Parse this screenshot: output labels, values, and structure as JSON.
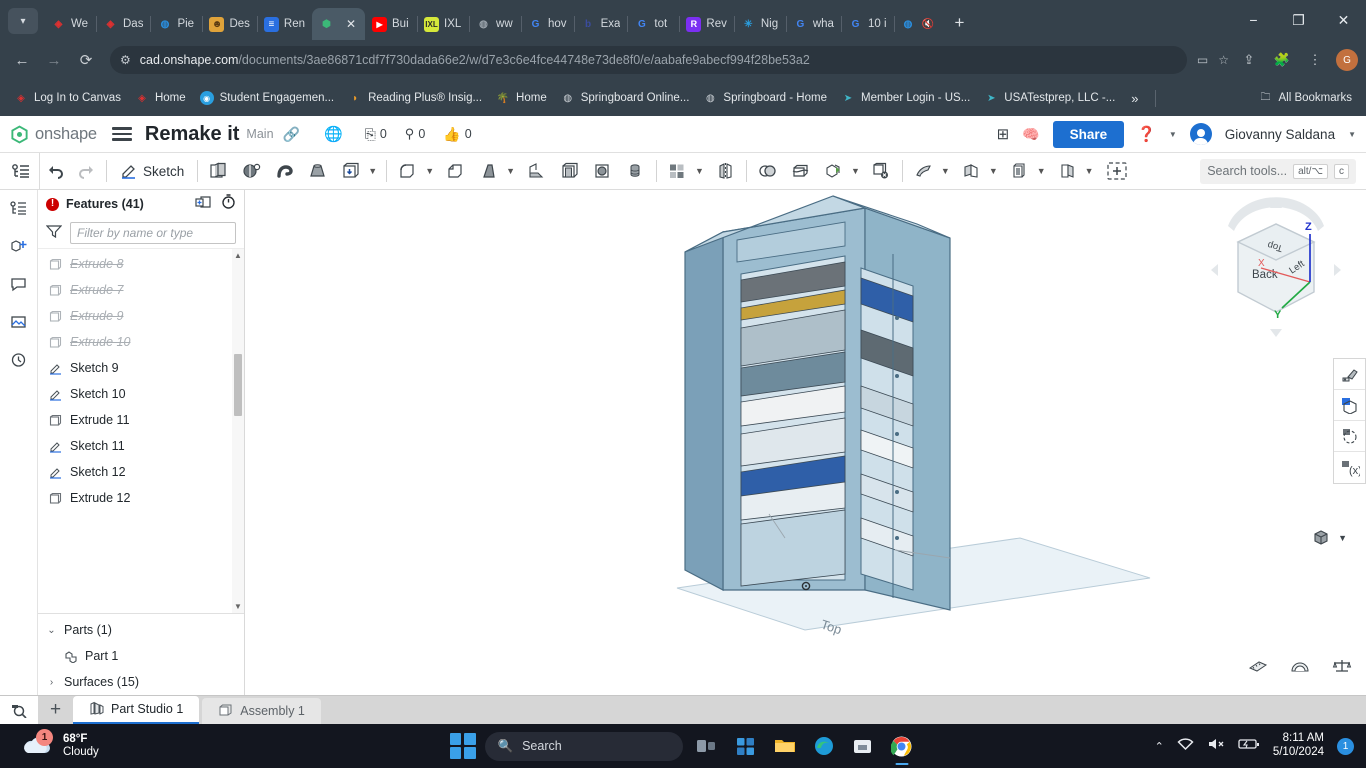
{
  "browser": {
    "tabs": [
      {
        "title": "We",
        "icon": "canvas-icon",
        "color": "#e03030",
        "active": false
      },
      {
        "title": "Das",
        "icon": "canvas-icon",
        "color": "#e03030",
        "active": false
      },
      {
        "title": "Pie",
        "icon": "globe-icon",
        "color": "#2a8fe0",
        "active": false
      },
      {
        "title": "Des",
        "icon": "person-icon",
        "color": "#e0a33a",
        "active": false
      },
      {
        "title": "Ren",
        "icon": "document-icon",
        "color": "#2a6fe0",
        "active": false
      },
      {
        "title": "",
        "icon": "onshape-icon",
        "color": "#3cb878",
        "active": true
      },
      {
        "title": "Bui",
        "icon": "youtube-icon",
        "color": "#ff0000",
        "active": false
      },
      {
        "title": "IXL",
        "icon": "ixl-icon",
        "color": "#d6e83a",
        "active": false
      },
      {
        "title": "ww",
        "icon": "globe-icon",
        "color": "#8a9096",
        "active": false
      },
      {
        "title": "hov",
        "icon": "google-icon",
        "color": "#4285f4",
        "active": false
      },
      {
        "title": "Exa",
        "icon": "bing-icon",
        "color": "#3b4c9e",
        "active": false
      },
      {
        "title": "tot",
        "icon": "google-icon",
        "color": "#4285f4",
        "active": false
      },
      {
        "title": "Rev",
        "icon": "revel-icon",
        "color": "#7b2ff2",
        "active": false
      },
      {
        "title": "Nig",
        "icon": "asterisk-icon",
        "color": "#2a9fe0",
        "active": false
      },
      {
        "title": "wha",
        "icon": "google-icon",
        "color": "#4285f4",
        "active": false
      },
      {
        "title": "10 i",
        "icon": "google-icon",
        "color": "#4285f4",
        "active": false
      },
      {
        "title": "",
        "icon": "bing-search-icon",
        "color": "#2a8fe0",
        "active": false
      }
    ],
    "tab_close_label": "✕",
    "new_tab_label": "+",
    "window_controls": [
      "−",
      "❐",
      "✕"
    ],
    "nav": {
      "back": "←",
      "forward": "→",
      "reload": "⟳",
      "site_settings_icon": "tune-icon",
      "url_host": "cad.onshape.com",
      "url_path": "/documents/3ae86871cdf7f730dada66e2/w/d7e3c6e4fce44748e73de8f0/e/aabafe9abecf994f28be53a2",
      "bookmark_star": "☆",
      "share_icon": "share-icon",
      "extensions_icon": "extensions-icon",
      "profile_initial": "G"
    },
    "bookmarks": [
      {
        "label": "Log In to Canvas",
        "icon": "canvas-icon",
        "color": "#e03030"
      },
      {
        "label": "Home",
        "icon": "canvas-icon",
        "color": "#e03030"
      },
      {
        "label": "Student Engagemen...",
        "icon": "circle-icon",
        "color": "#2a9fe0"
      },
      {
        "label": "Reading Plus® Insig...",
        "icon": "readingplus-icon",
        "color": "#e89a2a"
      },
      {
        "label": "Home",
        "icon": "palm-icon",
        "color": "#3cb878"
      },
      {
        "label": "Springboard Online...",
        "icon": "globe-icon",
        "color": "#9aa3ab"
      },
      {
        "label": "Springboard - Home",
        "icon": "globe-icon",
        "color": "#9aa3ab"
      },
      {
        "label": "Member Login - US...",
        "icon": "cursor-icon",
        "color": "#3fb6c8"
      },
      {
        "label": "USATestprep, LLC -...",
        "icon": "cursor-icon",
        "color": "#3fb6c8"
      }
    ],
    "bookmarks_overflow": "»",
    "all_bookmarks": "All Bookmarks"
  },
  "onshape": {
    "brand": "onshape",
    "document_title": "Remake it",
    "branch": "Main",
    "link_icon": "link-icon",
    "globe_icon": "globe-icon",
    "counts": [
      {
        "icon": "copy-icon",
        "value": "0"
      },
      {
        "icon": "pin-icon",
        "value": "0"
      },
      {
        "icon": "thumbsup-icon",
        "value": "0"
      }
    ],
    "apps_icon": "add-app-icon",
    "brain_icon": "brain-icon",
    "share_label": "Share",
    "help_icon": "help-icon",
    "user_name": "Giovanny Saldana",
    "toolbar": {
      "feature_list_icon": "feature-list-icon",
      "undo_icon": "undo-icon",
      "redo_icon": "redo-icon",
      "sketch_label": "Sketch",
      "search_placeholder": "Search tools...",
      "shortcut_keys": [
        "alt/⌥",
        "c"
      ],
      "tools": [
        "plane-icon",
        "mate-connector-icon",
        "sweep-icon",
        "loft-icon",
        "extrude-icon",
        "fillet-icon",
        "chamfer-icon",
        "draft-icon",
        "rib-icon",
        "shell-icon",
        "hole-icon",
        "thread-icon",
        "pattern-icon",
        "mirror-icon",
        "boolean-icon",
        "split-icon",
        "transform-icon",
        "delete-face-icon",
        "sheetmetal-icon",
        "bend-icon",
        "flatten-icon",
        "unfold-icon",
        "insert-icon"
      ]
    },
    "rail_icons": [
      "feature-tree-icon",
      "insert-part-icon",
      "comment-icon",
      "image-icon",
      "history-icon"
    ],
    "features": {
      "title": "Features (41)",
      "error_badge": "!",
      "add_folder_icon": "add-folder-icon",
      "rollback_icon": "timer-icon",
      "filter_icon": "filter-icon",
      "filter_placeholder": "Filter by name or type",
      "items": [
        {
          "label": "Extrude 8",
          "type": "extrude",
          "suppressed": true
        },
        {
          "label": "Extrude 7",
          "type": "extrude",
          "suppressed": true
        },
        {
          "label": "Extrude 9",
          "type": "extrude",
          "suppressed": true
        },
        {
          "label": "Extrude 10",
          "type": "extrude",
          "suppressed": true
        },
        {
          "label": "Sketch 9",
          "type": "sketch",
          "suppressed": false
        },
        {
          "label": "Sketch 10",
          "type": "sketch",
          "suppressed": false
        },
        {
          "label": "Extrude 11",
          "type": "extrude",
          "suppressed": false
        },
        {
          "label": "Sketch 11",
          "type": "sketch",
          "suppressed": false
        },
        {
          "label": "Sketch 12",
          "type": "sketch",
          "suppressed": false
        },
        {
          "label": "Extrude 12",
          "type": "extrude",
          "suppressed": false
        }
      ],
      "parts_group": "Parts (1)",
      "part_item": "Part 1",
      "surfaces_group": "Surfaces (15)"
    },
    "viewcube": {
      "front_face": "Back",
      "top_face": "Top",
      "side_face": "Left",
      "axis_x": "X",
      "axis_y": "Y",
      "axis_z": "Z",
      "plane_label": "Top",
      "colors": {
        "x": "#e35a5a",
        "y": "#22aa44",
        "z": "#2233cc"
      }
    },
    "view_display_icon": "display-style-icon",
    "right_tools": [
      "appearance-icon",
      "render-icon",
      "rotate-render-icon",
      "variable-icon"
    ],
    "bottom_tools": [
      "measure-icon",
      "angle-icon",
      "mass-icon"
    ],
    "tabs": {
      "magnify_icon": "search-doc-icon",
      "add_label": "+",
      "items": [
        {
          "label": "Part Studio 1",
          "icon": "part-studio-icon",
          "active": true
        },
        {
          "label": "Assembly 1",
          "icon": "assembly-icon",
          "active": false
        }
      ]
    },
    "model_colors": {
      "body": "#8fb4c8",
      "shelf": "#c8dae4",
      "accent": "#3f5e77"
    }
  },
  "taskbar": {
    "weather_temp": "68°F",
    "weather_cond": "Cloudy",
    "weather_badge": "1",
    "start_label": "start-icon",
    "search_placeholder": "Search",
    "apps": [
      "task-view-icon",
      "widgets-icon",
      "file-explorer-icon",
      "edge-icon",
      "store-icon",
      "chrome-icon"
    ],
    "tray": {
      "chevron": "⌃",
      "wifi_icon": "wifi-icon",
      "volume_icon": "volume-mute-icon",
      "battery_icon": "battery-icon",
      "time": "8:11 AM",
      "date": "5/10/2024",
      "notification_count": "1"
    }
  }
}
